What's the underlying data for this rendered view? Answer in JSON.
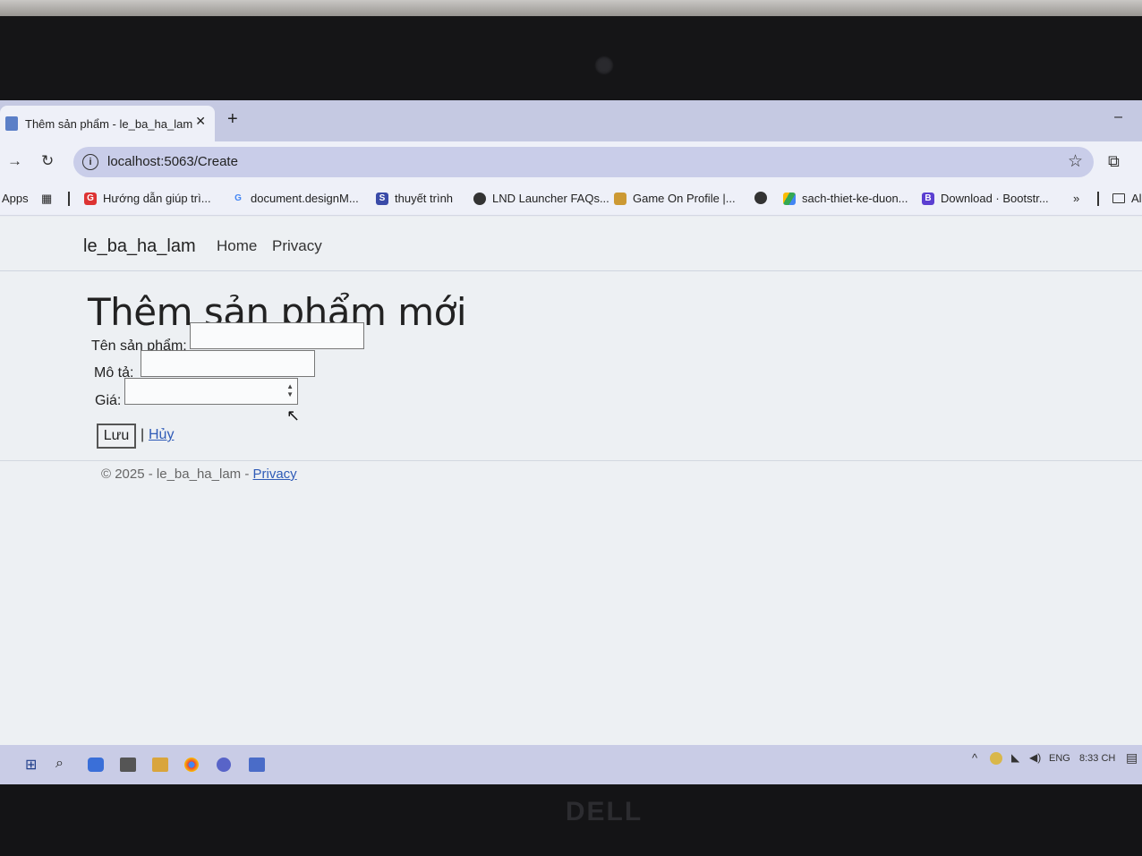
{
  "browser": {
    "tab": {
      "title": "Thêm sản phẩm - le_ba_ha_lam",
      "close": "✕",
      "new_tab": "+"
    },
    "minimize": "–",
    "omnibox": {
      "url": "localhost:5063/Create"
    },
    "bookmarks": [
      {
        "label": "Apps"
      },
      {
        "label": "Hướng dẫn giúp trì..."
      },
      {
        "label": "document.designM..."
      },
      {
        "label": "thuyết trình"
      },
      {
        "label": "LND Launcher FAQs..."
      },
      {
        "label": "Game On Profile |..."
      },
      {
        "label": "sach-thiet-ke-duon..."
      },
      {
        "label": "Download · Bootstr..."
      },
      {
        "label": "»"
      },
      {
        "label": "Al"
      }
    ]
  },
  "site": {
    "brand": "le_ba_ha_lam",
    "nav": [
      "Home",
      "Privacy"
    ]
  },
  "form": {
    "heading": "Thêm sản phẩm mới",
    "fields": [
      {
        "label": "Tên sản phẩm:",
        "value": ""
      },
      {
        "label": "Mô tả:",
        "value": ""
      },
      {
        "label": "Giá:",
        "value": ""
      }
    ],
    "save_label": "Lưu",
    "separator": "|",
    "cancel_label": "Hủy"
  },
  "footer": {
    "text": "© 2025 - le_ba_ha_lam - ",
    "privacy_link": "Privacy"
  },
  "taskbar": {
    "tray": {
      "language": "ENG",
      "clock": "8:33 CH"
    }
  },
  "hardware": {
    "brand": "DELL"
  }
}
